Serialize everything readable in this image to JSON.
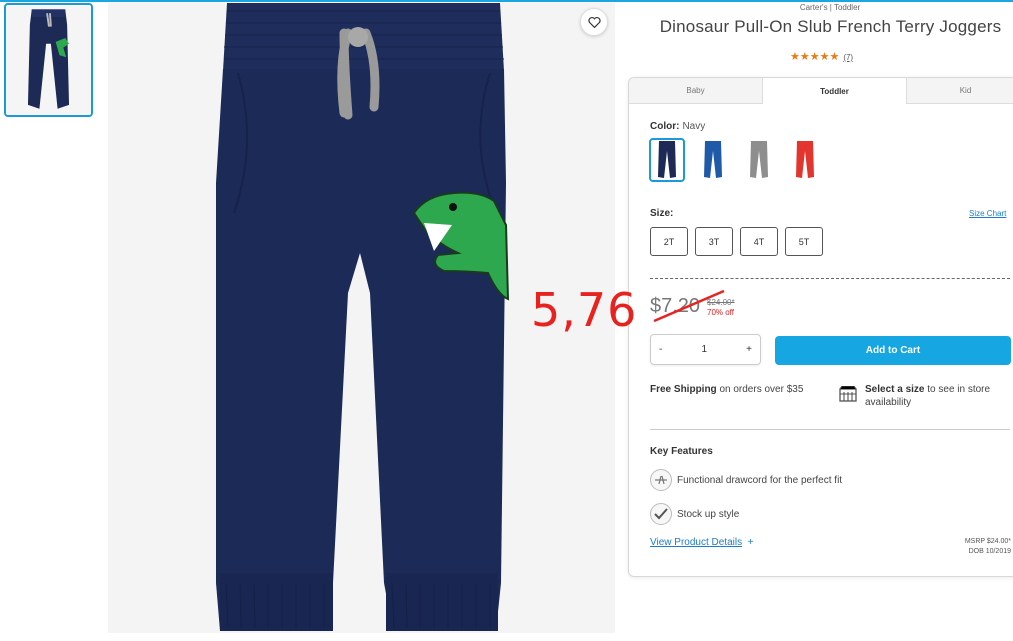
{
  "product": {
    "brand": "Carter's | Toddler",
    "title": "Dinosaur Pull-On Slub French Terry Joggers",
    "stars": "★★★★★",
    "review_count": "(7)",
    "rating": 5
  },
  "tabs": [
    "Baby",
    "Toddler",
    "Kid"
  ],
  "color": {
    "label": "Color:",
    "value": "Navy",
    "swatches": [
      {
        "name": "navy",
        "hex": "#1c2a55"
      },
      {
        "name": "blue",
        "hex": "#1f5aa8"
      },
      {
        "name": "gray",
        "hex": "#8e8e8e"
      },
      {
        "name": "red",
        "hex": "#e2352e"
      }
    ]
  },
  "size": {
    "label": "Size:",
    "chart_link": "Size Chart",
    "options": [
      "2T",
      "3T",
      "4T",
      "5T"
    ]
  },
  "pricing": {
    "sale": "$7.20",
    "original": "$24.00*",
    "discount": "70% off",
    "overlay_annotation": "5,76"
  },
  "quantity": {
    "minus": "-",
    "value": "1",
    "plus": "+"
  },
  "add_to_cart": "Add to Cart",
  "shipping": {
    "bold": "Free Shipping",
    "rest": " on orders over $35"
  },
  "store": {
    "bold": "Select a size",
    "rest": " to see in store availability"
  },
  "key_features": {
    "title": "Key Features",
    "items": [
      "Functional drawcord for the perfect fit",
      "Stock up style"
    ]
  },
  "details_link": {
    "label": "View Product Details",
    "icon": "+"
  },
  "msrp": {
    "line1": "MSRP $24.00*",
    "line2": "DOB 10/2019"
  },
  "colors": {
    "accent": "#16a6e2",
    "annotation": "#e8231f",
    "star": "#e97a14"
  }
}
